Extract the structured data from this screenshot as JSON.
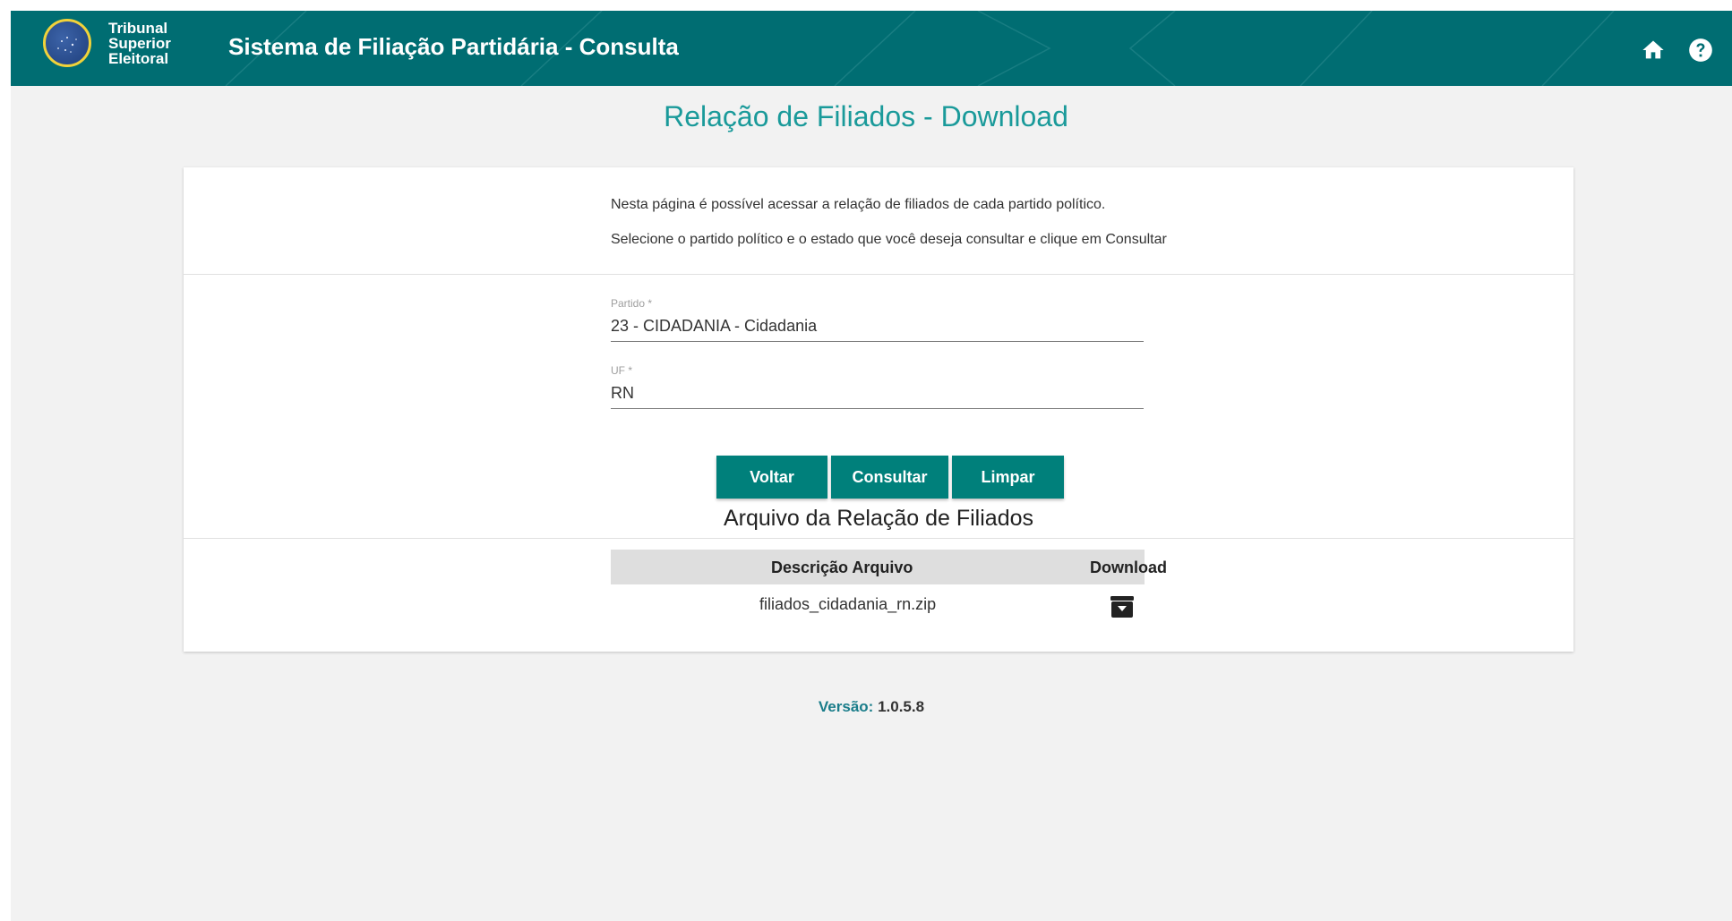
{
  "header": {
    "logo_lines": [
      "Tribunal",
      "Superior",
      "Eleitoral"
    ],
    "app_title": "Sistema de Filiação Partidária - Consulta",
    "icons": [
      "home-icon",
      "help-icon"
    ]
  },
  "page_title": "Relação de Filiados - Download",
  "intro": {
    "line1": "Nesta página é possível acessar a relação de filiados de cada partido político.",
    "line2": "Selecione o partido político e o estado que você deseja consultar e clique em Consultar"
  },
  "form": {
    "partido": {
      "label": "Partido *",
      "value": "23 - CIDADANIA - Cidadania"
    },
    "uf": {
      "label": "UF *",
      "value": "RN"
    }
  },
  "buttons": {
    "voltar": "Voltar",
    "consultar": "Consultar",
    "limpar": "Limpar"
  },
  "arquivo": {
    "title": "Arquivo da Relação de Filiados",
    "columns": [
      "Descrição Arquivo",
      "Download"
    ],
    "rows": [
      {
        "descricao": "filiados_cidadania_rn.zip",
        "download_icon": "download-icon"
      }
    ]
  },
  "footer": {
    "version_label": "Versão:",
    "version_value": "1.0.5.8"
  },
  "colors": {
    "header_bg": "#006d72",
    "accent": "#1a9a9a",
    "button_bg": "#00807b",
    "page_bg": "#f2f2f2"
  }
}
